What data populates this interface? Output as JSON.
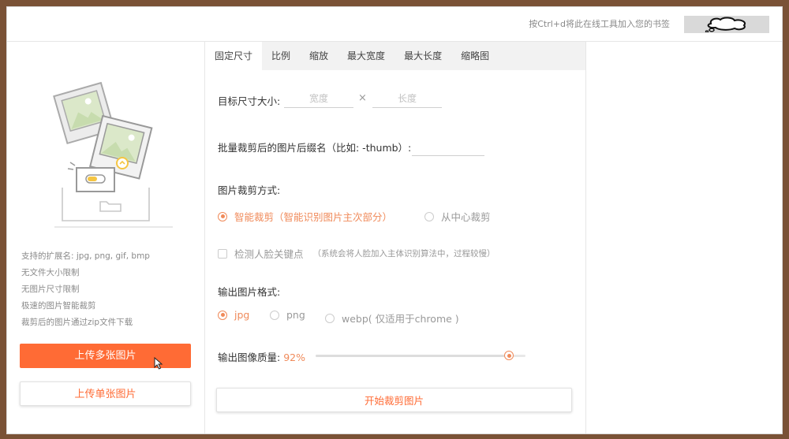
{
  "header": {
    "bookmark_tip": "按Ctrl+d将此在线工具加入您的书签",
    "cloud_icon": "cloud-icon"
  },
  "sidebar": {
    "illustration_icon": "image-upload-illustration",
    "features": [
      "支持的扩展名: jpg, png, gif, bmp",
      "无文件大小限制",
      "无图片尺寸限制",
      "极速的图片智能裁剪",
      "裁剪后的图片通过zip文件下载"
    ],
    "upload_multi_label": "上传多张图片",
    "upload_single_label": "上传单张图片"
  },
  "tabs": [
    "固定尺寸",
    "比例",
    "缩放",
    "最大宽度",
    "最大长度",
    "缩略图"
  ],
  "active_tab_index": 0,
  "form": {
    "target_size_label": "目标尺寸大小:",
    "width_placeholder": "宽度",
    "times": "×",
    "height_placeholder": "长度",
    "suffix_label": "批量裁剪后的图片后缀名（比如: -thumb）:",
    "suffix_value": "",
    "crop_mode_label": "图片裁剪方式:",
    "crop_modes": [
      {
        "label": "智能裁剪（智能识别图片主次部分）",
        "selected": true
      },
      {
        "label": "从中心裁剪",
        "selected": false
      }
    ],
    "face_detect_label": "检测人脸关键点",
    "face_detect_checked": false,
    "face_detect_hint": "（系统会将人脸加入主体识别算法中，过程较慢）",
    "format_label": "输出图片格式:",
    "formats": [
      {
        "label": "jpg",
        "selected": true
      },
      {
        "label": "png",
        "selected": false
      },
      {
        "label": "webp( 仅适用于chrome )",
        "selected": false
      }
    ],
    "quality_label": "输出图像质量:",
    "quality_value": "92%",
    "quality_percent": 92,
    "start_button_label": "开始裁剪图片"
  },
  "colors": {
    "accent": "#ff6b35",
    "accent_soft": "#f08a5a"
  }
}
